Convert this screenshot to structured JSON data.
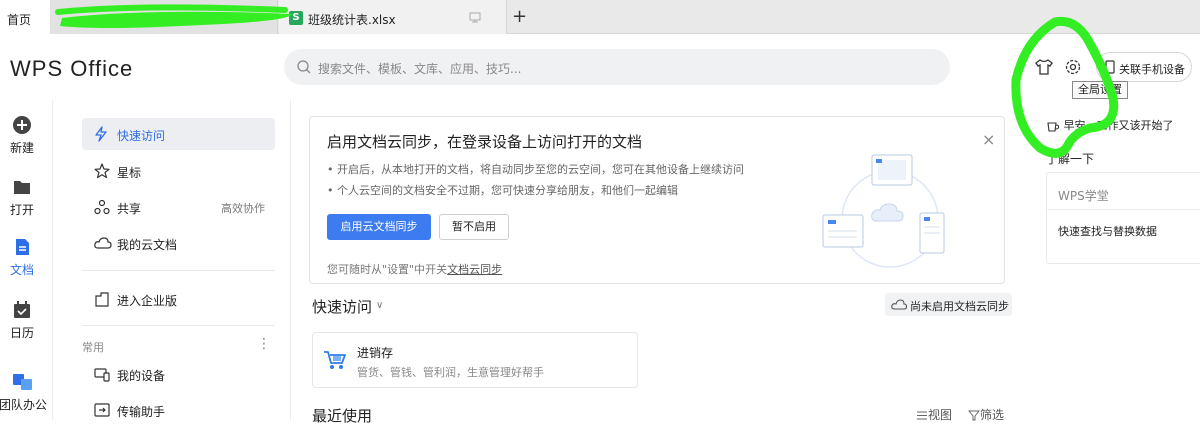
{
  "tabs": {
    "home": "首页",
    "file_tab": "班级统计表.xlsx",
    "xls_badge": "S",
    "new_tab": "+"
  },
  "header": {
    "logo": "WPS Office",
    "search_placeholder": "搜索文件、模板、文库、应用、技巧...",
    "bind_phone": "关联手机设备",
    "tooltip": "全局设置"
  },
  "rail": [
    {
      "label": "新建"
    },
    {
      "label": "打开"
    },
    {
      "label": "文档"
    },
    {
      "label": "日历"
    },
    {
      "label": "团队办公"
    }
  ],
  "nav": {
    "quick_access": "快速访问",
    "starred": "星标",
    "shared": "共享",
    "shared_extra": "高效协作",
    "cloud_docs": "我的云文档",
    "enterprise": "进入企业版",
    "section_common": "常用",
    "more": "⋮",
    "my_devices": "我的设备",
    "transfer": "传输助手"
  },
  "sync_card": {
    "title": "启用文档云同步，在登录设备上访问打开的文档",
    "bullet1": "• 开启后，从本地打开的文档，将自动同步至您的云空间，您可在其他设备上继续访问",
    "bullet2": "• 个人云空间的文档安全不过期，您可快速分享给朋友，和他们一起编辑",
    "enable_button": "启用云文档同步",
    "later_button": "暂不启用",
    "note_prefix": "您可随时从\"设置\"中开关",
    "note_link": "文档云同步",
    "close": "×"
  },
  "quick_access": {
    "title": "快速访问",
    "chevron": "∨",
    "cloud_status": "尚未启用文档云同步",
    "app_title": "进销存",
    "app_desc": "管货、管钱、管利润，生意管理好帮手"
  },
  "recent": {
    "title": "最近使用",
    "view": "视图",
    "filter": "筛选"
  },
  "right_panel": {
    "greeting": "早安，工作又该开始了",
    "learn_more": "了解一下",
    "school_title": "WPS学堂",
    "school_link": "快速查找与替换数据"
  },
  "colors": {
    "accent": "#2e6ee6",
    "button_blue": "#3d7cf0",
    "xls_green": "#27a85b",
    "scribble_green": "#33ee22"
  }
}
